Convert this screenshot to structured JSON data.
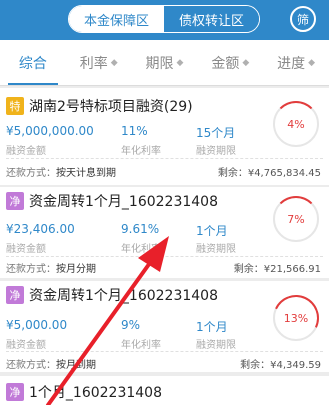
{
  "header": {
    "segments": [
      "本金保障区",
      "债权转让区"
    ],
    "filter_label": "筛"
  },
  "tabs": [
    {
      "label": "综合",
      "has_chevron": false
    },
    {
      "label": "利率",
      "has_chevron": true
    },
    {
      "label": "期限",
      "has_chevron": true
    },
    {
      "label": "金额",
      "has_chevron": true
    },
    {
      "label": "进度",
      "has_chevron": true
    }
  ],
  "chevron_glyph": "◆",
  "labels": {
    "amount": "融资金额",
    "rate": "年化利率",
    "period": "融资期限",
    "repay_prefix": "还款方式：",
    "remain_prefix": "剩余："
  },
  "cards": [
    {
      "badge": "特",
      "badge_color": "#f0b31b",
      "title": "湖南2号特标项目融资(29)",
      "amount": "¥5,000,000.00",
      "rate": "11%",
      "period": "15个月",
      "repay": "按天计息到期",
      "remain": "¥4,765,834.45",
      "progress": 4,
      "progress_text": "4%"
    },
    {
      "badge": "净",
      "badge_color": "#c17ad8",
      "title": "资金周转1个月_1602231408",
      "amount": "¥23,406.00",
      "rate": "9.61%",
      "period": "1个月",
      "repay": "按月分期",
      "remain": "¥21,566.91",
      "progress": 7,
      "progress_text": "7%"
    },
    {
      "badge": "净",
      "badge_color": "#c17ad8",
      "title": "资金周转1个月_1602231408",
      "amount": "¥5,000.00",
      "rate": "9%",
      "period": "1个月",
      "repay": "按月到期",
      "remain": "¥4,349.59",
      "progress": 13,
      "progress_text": "13%"
    },
    {
      "badge": "净",
      "badge_color": "#c17ad8",
      "title": "1个月_1602231408"
    }
  ]
}
